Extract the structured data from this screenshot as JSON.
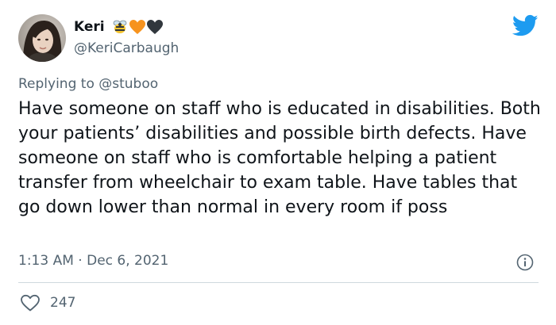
{
  "author": {
    "display_name": "Keri",
    "handle": "@KeriCarbaugh",
    "name_emojis": [
      "bee-emoji",
      "orange-heart-emoji",
      "black-heart-emoji"
    ]
  },
  "reply": {
    "prefix": "Replying to",
    "mention": "@stuboo"
  },
  "tweet": {
    "text": "Have someone on staff who is educated in disabilities. Both your patients’ disabilities and possible birth defects. Have someone on staff who is comfortable helping a patient transfer from wheelchair to exam table. Have tables that go down lower than normal in every room if poss"
  },
  "meta": {
    "time": "1:13 AM",
    "separator": "·",
    "date": "Dec 6, 2021"
  },
  "stats": {
    "likes": "247"
  },
  "icons": {
    "brand": "twitter-bird-icon",
    "info": "info-icon",
    "like": "heart-outline-icon"
  },
  "colors": {
    "brand_blue": "#1d9bf0",
    "secondary_text": "#536471",
    "primary_text": "#0f1419",
    "orange_heart": "#f7931e",
    "black_heart": "#31373d"
  }
}
